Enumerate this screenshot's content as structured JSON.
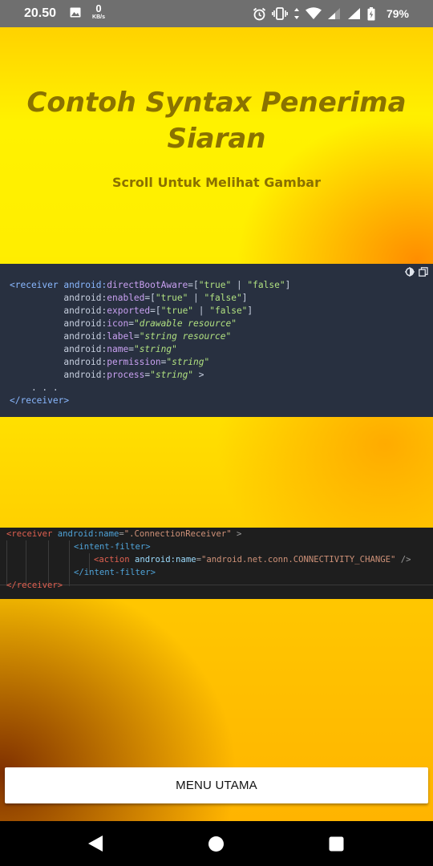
{
  "status_bar": {
    "time": "20.50",
    "net_speed_value": "0",
    "net_speed_unit": "KB/s",
    "battery_percent": "79%",
    "icons": [
      "image-icon",
      "alarm-icon",
      "vibrate-icon",
      "data-arrows-icon",
      "wifi-icon",
      "signal-icon",
      "signal-icon",
      "battery-icon"
    ]
  },
  "header": {
    "title": "Contoh Syntax Penerima Siaran",
    "subtitle": "Scroll Untuk Melihat Gambar"
  },
  "code_image_1": {
    "lines": [
      [
        "<receiver android:",
        "directBootAware",
        "=[",
        "\"true\"",
        " | ",
        "\"false\"",
        "]"
      ],
      [
        "android:",
        "enabled",
        "=[",
        "\"true\"",
        " | ",
        "\"false\"",
        "]"
      ],
      [
        "android:",
        "exported",
        "=[",
        "\"true\"",
        " | ",
        "\"false\"",
        "]"
      ],
      [
        "android:",
        "icon",
        "=",
        "\"drawable resource\""
      ],
      [
        "android:",
        "label",
        "=",
        "\"string resource\""
      ],
      [
        "android:",
        "name",
        "=",
        "\"string\""
      ],
      [
        "android:",
        "permission",
        "=",
        "\"string\""
      ],
      [
        "android:",
        "process",
        "=",
        "\"string\"",
        " >"
      ]
    ],
    "ellipsis": ". . .",
    "closing": "</receiver>"
  },
  "code_image_2": {
    "line1": [
      "<receiver",
      " android:name",
      "=",
      "\".ConnectionReceiver\"",
      " >"
    ],
    "line2": [
      "<intent-filter>"
    ],
    "line3": [
      "<action",
      " android:name",
      "=",
      "\"android.net.conn.CONNECTIVITY_CHANGE\"",
      " />"
    ],
    "line4": [
      "</intent-filter>"
    ],
    "line5": [
      "</receiver>"
    ]
  },
  "menu_button": {
    "label": "MENU UTAMA"
  },
  "colors": {
    "background_yellow": "#ffee00",
    "title_color": "#8a7200",
    "code_bg": "#283040"
  }
}
